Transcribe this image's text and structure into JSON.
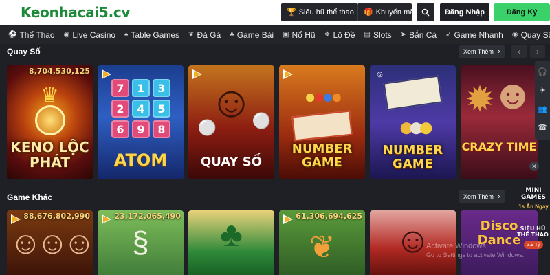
{
  "header": {
    "logo_text": "Keonhacai5",
    "logo_suffix": ".cv",
    "jackpot_button": "Siêu hũ thể thao",
    "promo_button": "Khuyến mãi",
    "login_button": "Đăng Nhập",
    "register_button": "Đăng Ký"
  },
  "nav": [
    {
      "label": "Thể Thao",
      "icon": "soccer-icon",
      "glyph": "⚽"
    },
    {
      "label": "Live Casino",
      "icon": "casino-chip-icon",
      "glyph": "◉"
    },
    {
      "label": "Table Games",
      "icon": "cards-icon",
      "glyph": "♠"
    },
    {
      "label": "Đá Gà",
      "icon": "rooster-icon",
      "glyph": "❦"
    },
    {
      "label": "Game Bài",
      "icon": "playing-card-icon",
      "glyph": "♣"
    },
    {
      "label": "Nổ Hũ",
      "icon": "slot-jar-icon",
      "glyph": "▣"
    },
    {
      "label": "Lô Đề",
      "icon": "lottery-icon",
      "glyph": "❖"
    },
    {
      "label": "Slots",
      "icon": "slot-machine-icon",
      "glyph": "▤"
    },
    {
      "label": "Bắn Cá",
      "icon": "fish-icon",
      "glyph": "➤"
    },
    {
      "label": "Game Nhanh",
      "icon": "rocket-icon",
      "glyph": "➶"
    },
    {
      "label": "Quay Số",
      "icon": "lottery-ball-icon",
      "glyph": "◉"
    }
  ],
  "sections": {
    "lottery": {
      "title": "Quay Số",
      "more": "Xem Thêm",
      "games": [
        {
          "name": "KENO LỘC PHÁT",
          "amount": "8,704,530,125"
        },
        {
          "name": "ATOM",
          "amount": ""
        },
        {
          "name": "QUAY SỐ",
          "amount": ""
        },
        {
          "name": "NUMBER GAME",
          "amount": ""
        },
        {
          "name": "NUMBER GAME",
          "amount": ""
        },
        {
          "name": "CRAZY TIME",
          "amount": ""
        }
      ]
    },
    "other": {
      "title": "Game Khác",
      "more": "Xem Thêm",
      "games": [
        {
          "amount": "88,676,802,990"
        },
        {
          "amount": "23,172,065,490"
        },
        {
          "amount": ""
        },
        {
          "amount": "61,306,694,625"
        },
        {
          "amount": ""
        },
        {
          "name": "Disco Dance",
          "amount": ""
        }
      ]
    }
  },
  "atom_numbers": [
    "7",
    "1",
    "3",
    "2",
    "4",
    "5",
    "6",
    "9",
    "8"
  ],
  "floating": {
    "mini_games_title": "MINI GAMES",
    "mini_games_sub": "1s Ăn Ngay",
    "jackpot_title": "SIÊU HŨ THỂ THAO",
    "jackpot_sub": "3.9 Tỷ"
  },
  "watermark": {
    "line1": "Activate Windows",
    "line2": "Go to Settings to activate Windows."
  },
  "colors": {
    "brand_green": "#1c8a3a",
    "register_green": "#3ad06a",
    "background": "#1e2026",
    "gold": "#f6d37a"
  }
}
